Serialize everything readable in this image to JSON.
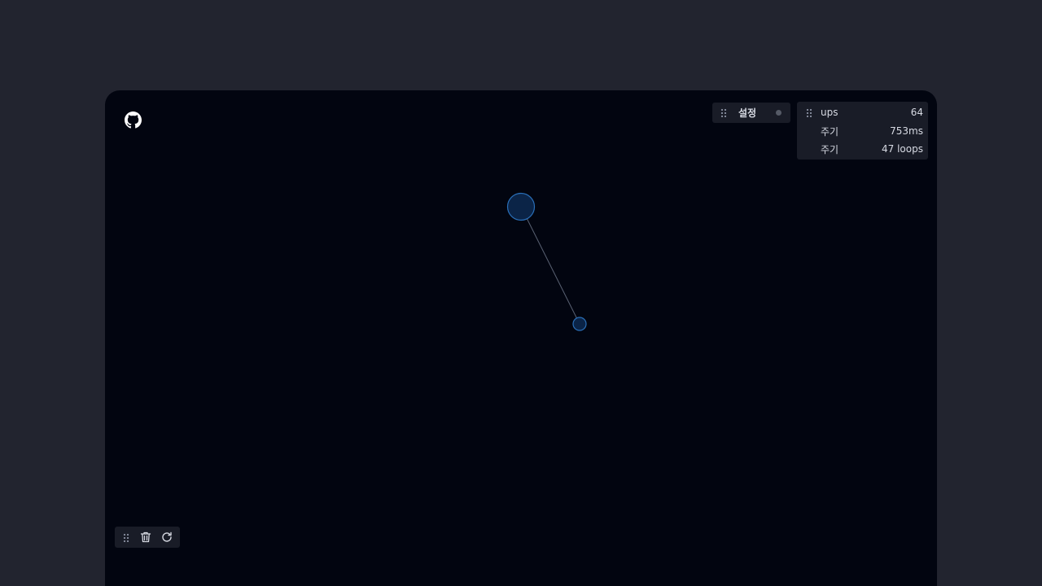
{
  "header": {
    "github_icon": "github-icon"
  },
  "settings_panel": {
    "label": "설정",
    "status_color": "#555a66"
  },
  "stats": [
    {
      "key": "ups",
      "value": "64"
    },
    {
      "key": "주기",
      "value": "753ms"
    },
    {
      "key": "주기",
      "value": "47 loops"
    }
  ],
  "toolbar": {
    "icons": [
      "grip-icon",
      "trash-icon",
      "refresh-icon"
    ]
  },
  "graph": {
    "node_fill": "#0b2447",
    "node_stroke": "#2a6fb8",
    "edge_color": "#5a6273"
  }
}
